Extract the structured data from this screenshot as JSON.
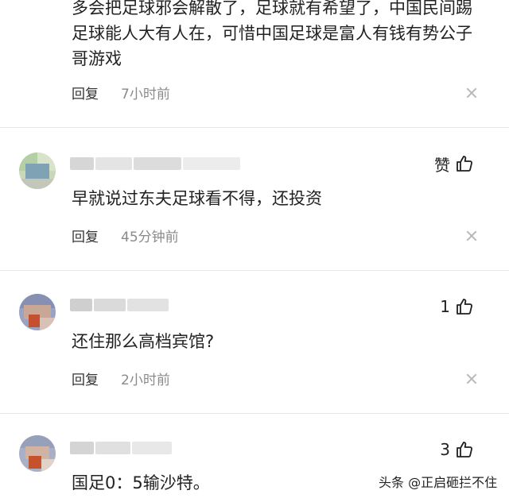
{
  "comments": [
    {
      "text_lines": [
        "多会把足球邪会解散了，足球就有希望了，中国民间踢",
        "足球能人大有人在，可惜中国足球是富人有钱有势公子",
        "哥游戏"
      ],
      "reply_label": "回复",
      "time": "7小时前"
    },
    {
      "like_label": "赞",
      "text": "早就说过东夫足球看不得，还投资",
      "reply_label": "回复",
      "time": "45分钟前"
    },
    {
      "like_count": "1",
      "text": "还住那么高档宾馆?",
      "reply_label": "回复",
      "time": "2小时前"
    },
    {
      "like_count": "3",
      "text": "国足0：5输沙特。"
    }
  ],
  "watermark": "头条 @正启砸拦不住",
  "colors": {
    "divider": "#e6e6e6",
    "muted_text": "#8a8a8a",
    "icon": "#1f1f1f"
  },
  "icons": [
    "thumbs-up-icon",
    "close-icon"
  ]
}
